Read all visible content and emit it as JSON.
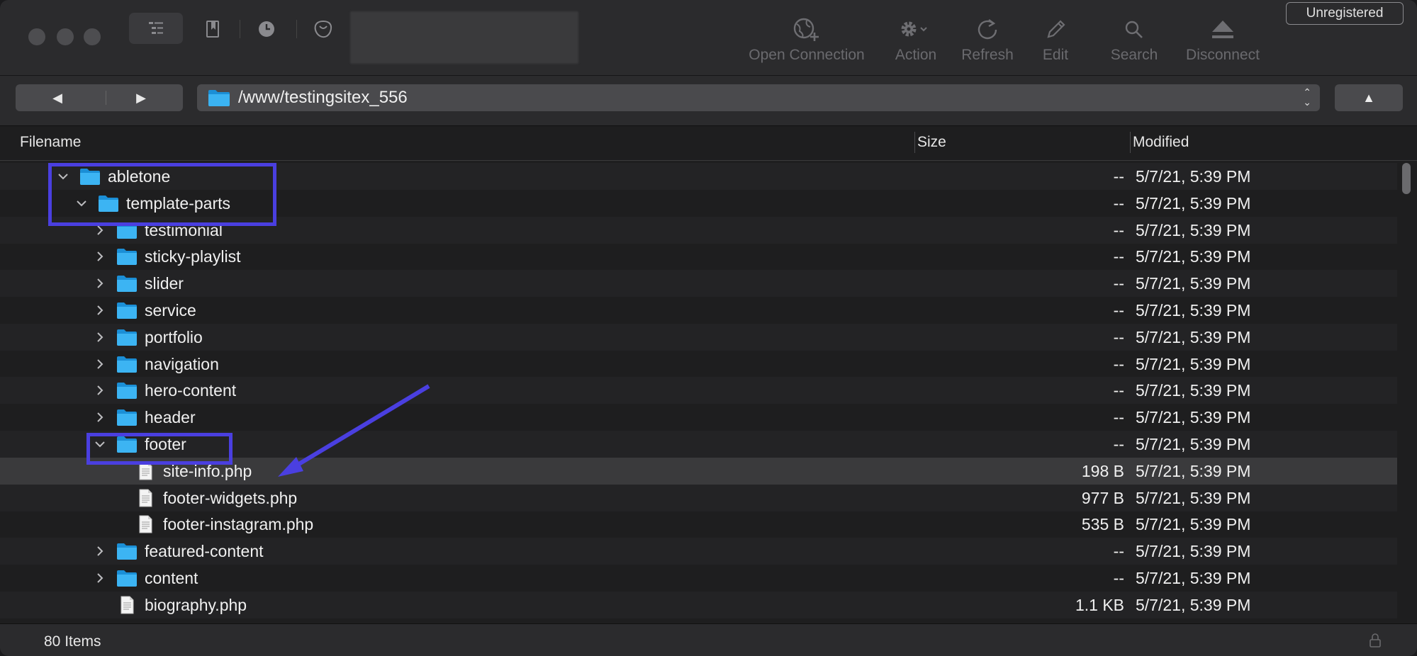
{
  "toolbar": {
    "tools": [
      {
        "name": "open-connection",
        "label": "Open Connection",
        "icon": "globe-plus-icon"
      },
      {
        "name": "action",
        "label": "Action",
        "icon": "gear-icon"
      },
      {
        "name": "refresh",
        "label": "Refresh",
        "icon": "refresh-icon"
      },
      {
        "name": "edit",
        "label": "Edit",
        "icon": "pencil-icon"
      },
      {
        "name": "search",
        "label": "Search",
        "icon": "search-icon"
      },
      {
        "name": "disconnect",
        "label": "Disconnect",
        "icon": "eject-icon"
      }
    ],
    "unregistered_label": "Unregistered"
  },
  "pathbar": {
    "back": "◀",
    "forward": "▶",
    "path": "/www/testingsitex_556",
    "up": "▲"
  },
  "columns": {
    "filename": "Filename",
    "size": "Size",
    "modified": "Modified"
  },
  "rows": [
    {
      "name": "abletone",
      "type": "folder",
      "indent": 0,
      "expanded": true,
      "size": "--",
      "modified": "5/7/21, 5:39 PM"
    },
    {
      "name": "template-parts",
      "type": "folder",
      "indent": 1,
      "expanded": true,
      "size": "--",
      "modified": "5/7/21, 5:39 PM"
    },
    {
      "name": "testimonial",
      "type": "folder",
      "indent": 2,
      "expanded": false,
      "size": "--",
      "modified": "5/7/21, 5:39 PM"
    },
    {
      "name": "sticky-playlist",
      "type": "folder",
      "indent": 2,
      "expanded": false,
      "size": "--",
      "modified": "5/7/21, 5:39 PM"
    },
    {
      "name": "slider",
      "type": "folder",
      "indent": 2,
      "expanded": false,
      "size": "--",
      "modified": "5/7/21, 5:39 PM"
    },
    {
      "name": "service",
      "type": "folder",
      "indent": 2,
      "expanded": false,
      "size": "--",
      "modified": "5/7/21, 5:39 PM"
    },
    {
      "name": "portfolio",
      "type": "folder",
      "indent": 2,
      "expanded": false,
      "size": "--",
      "modified": "5/7/21, 5:39 PM"
    },
    {
      "name": "navigation",
      "type": "folder",
      "indent": 2,
      "expanded": false,
      "size": "--",
      "modified": "5/7/21, 5:39 PM"
    },
    {
      "name": "hero-content",
      "type": "folder",
      "indent": 2,
      "expanded": false,
      "size": "--",
      "modified": "5/7/21, 5:39 PM"
    },
    {
      "name": "header",
      "type": "folder",
      "indent": 2,
      "expanded": false,
      "size": "--",
      "modified": "5/7/21, 5:39 PM"
    },
    {
      "name": "footer",
      "type": "folder",
      "indent": 2,
      "expanded": true,
      "size": "--",
      "modified": "5/7/21, 5:39 PM"
    },
    {
      "name": "site-info.php",
      "type": "file",
      "indent": 3,
      "size": "198 B",
      "modified": "5/7/21, 5:39 PM",
      "selected": true
    },
    {
      "name": "footer-widgets.php",
      "type": "file",
      "indent": 3,
      "size": "977 B",
      "modified": "5/7/21, 5:39 PM"
    },
    {
      "name": "footer-instagram.php",
      "type": "file",
      "indent": 3,
      "size": "535 B",
      "modified": "5/7/21, 5:39 PM"
    },
    {
      "name": "featured-content",
      "type": "folder",
      "indent": 2,
      "expanded": false,
      "size": "--",
      "modified": "5/7/21, 5:39 PM"
    },
    {
      "name": "content",
      "type": "folder",
      "indent": 2,
      "expanded": false,
      "size": "--",
      "modified": "5/7/21, 5:39 PM"
    },
    {
      "name": "biography.php",
      "type": "file",
      "indent": 2,
      "size": "1.1 KB",
      "modified": "5/7/21, 5:39 PM"
    }
  ],
  "status": {
    "item_count": "80 Items"
  },
  "colors": {
    "highlight": "#4a3fe0",
    "folder": "#2aa6ea"
  }
}
